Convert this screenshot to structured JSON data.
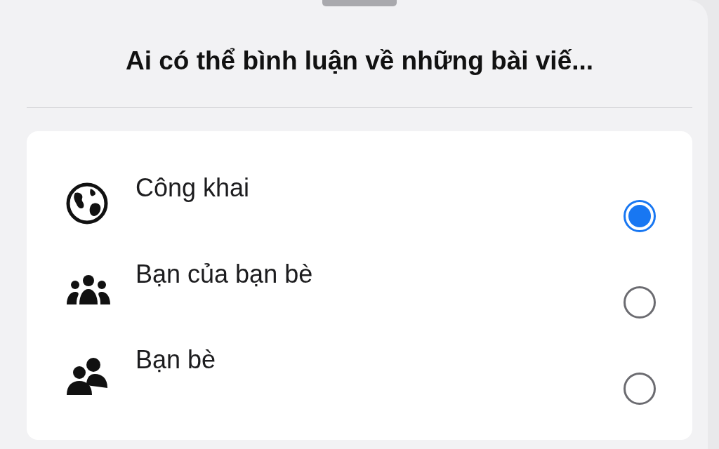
{
  "sheet": {
    "title": "Ai có thể bình luận về những bài viế..."
  },
  "options": [
    {
      "kind": "globe",
      "label": "Công khai",
      "selected": true
    },
    {
      "kind": "group",
      "label": "Bạn của bạn bè",
      "selected": false
    },
    {
      "kind": "pair",
      "label": "Bạn bè",
      "selected": false
    }
  ]
}
